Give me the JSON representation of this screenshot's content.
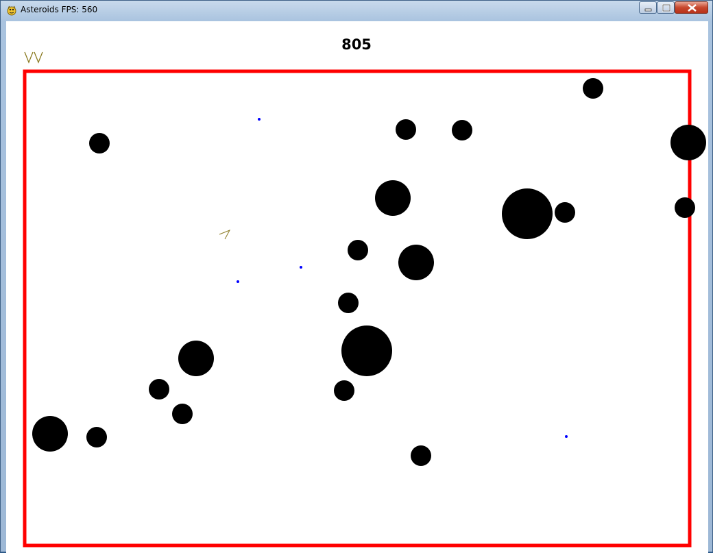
{
  "window": {
    "title": "Asteroids FPS: 560"
  },
  "hud": {
    "score": "805",
    "lives": 2,
    "lives_color": "#8a7a20"
  },
  "colors": {
    "border": "#ff0000",
    "asteroid": "#000000",
    "bullet": "#0000ff",
    "ship": "#8a7a20",
    "background": "#ffffff"
  },
  "icons": {
    "app": "pygame-snake-icon",
    "minimize": "minimize-icon",
    "maximize": "maximize-icon",
    "close": "close-icon"
  }
}
